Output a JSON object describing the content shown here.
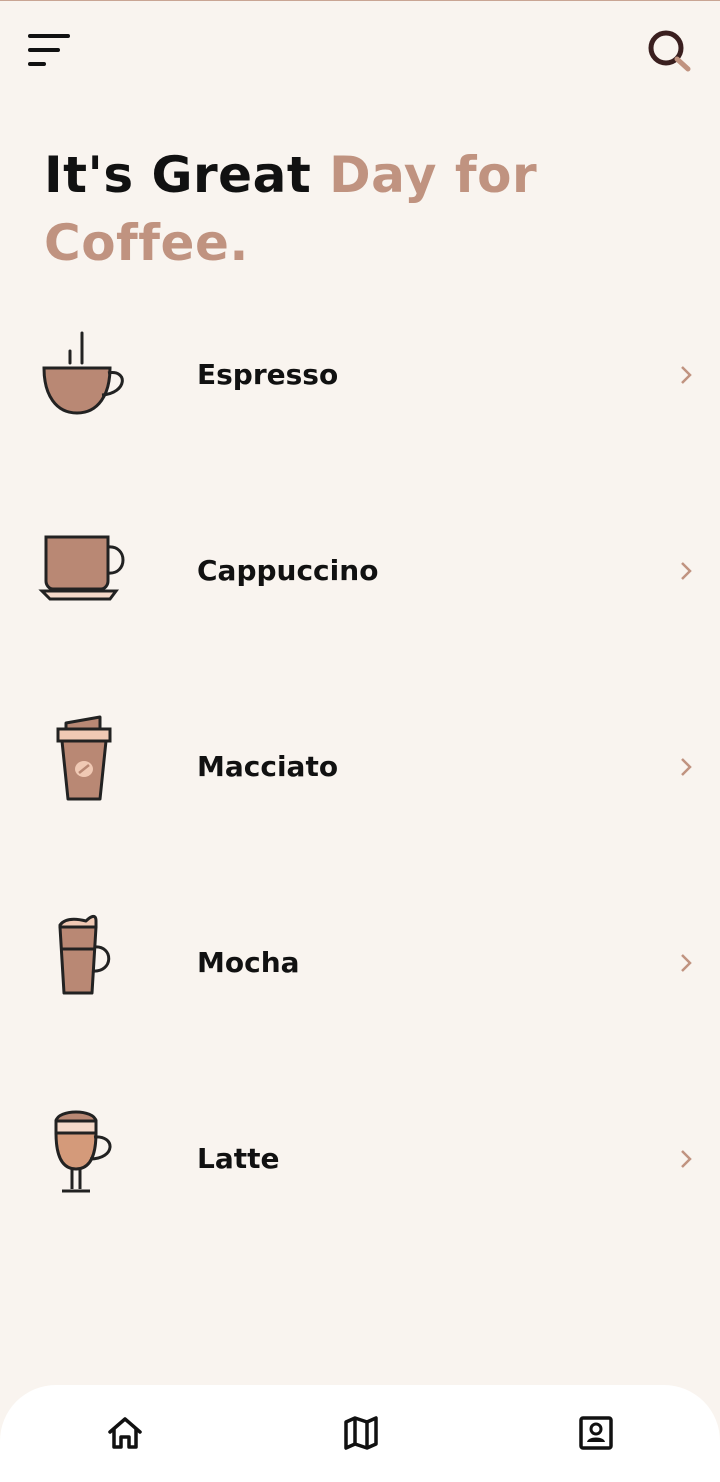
{
  "headline": {
    "part1": "It's Great ",
    "part2": "Day for Coffee."
  },
  "colors": {
    "background": "#f9f4ef",
    "accent": "#c09380",
    "text": "#111111",
    "icon_fill": "#b98874"
  },
  "header": {
    "menu_icon": "menu-icon",
    "search_icon": "search-icon"
  },
  "coffees": [
    {
      "name": "Espresso",
      "icon": "espresso-cup-icon"
    },
    {
      "name": "Cappuccino",
      "icon": "cappuccino-cup-icon"
    },
    {
      "name": "Macciato",
      "icon": "takeaway-cup-icon"
    },
    {
      "name": "Mocha",
      "icon": "mocha-glass-icon"
    },
    {
      "name": "Latte",
      "icon": "latte-glass-icon"
    }
  ],
  "nav": [
    {
      "icon": "home-icon"
    },
    {
      "icon": "map-icon"
    },
    {
      "icon": "profile-icon"
    }
  ]
}
